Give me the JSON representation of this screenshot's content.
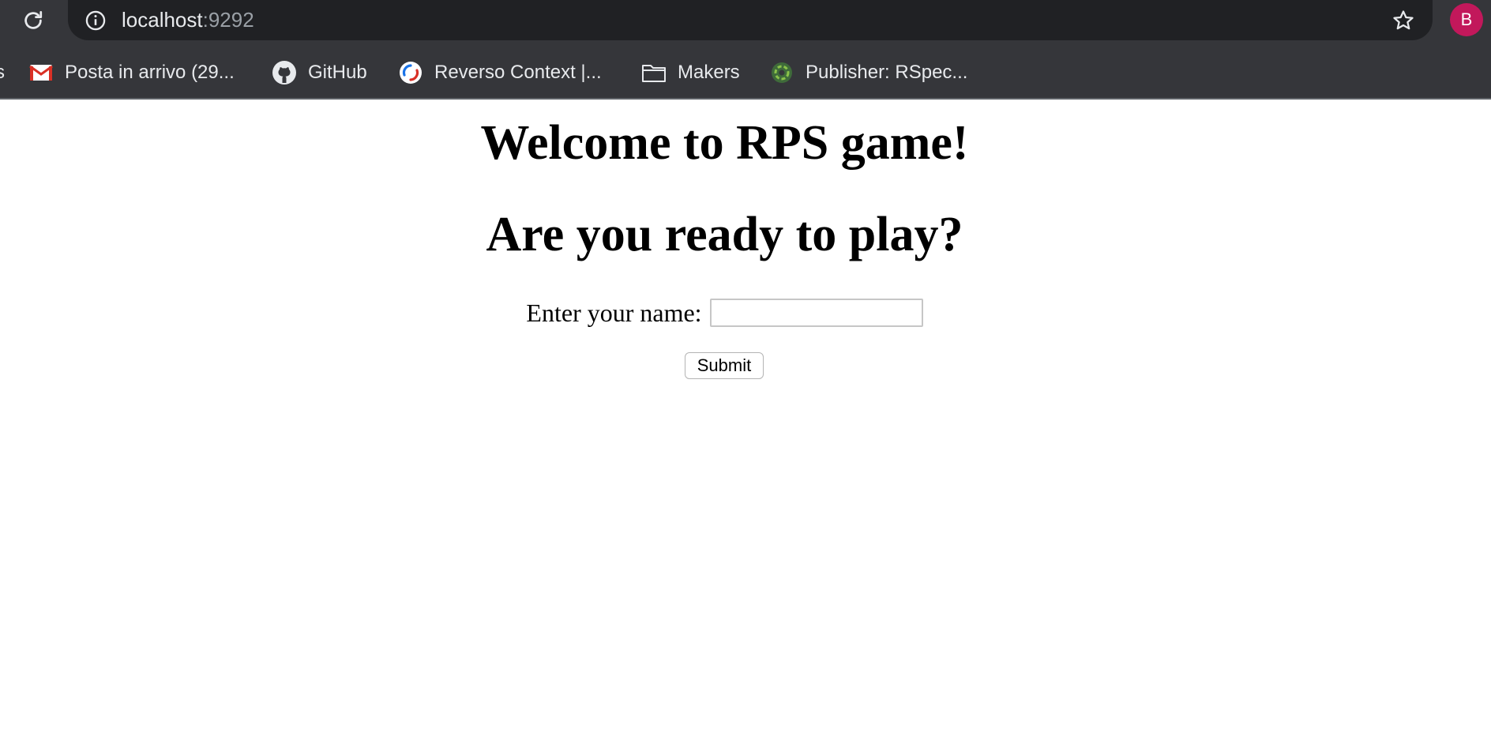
{
  "browser": {
    "url_host": "localhost",
    "url_port": ":9292",
    "profile_initial": "B",
    "bookmarks": [
      {
        "label": "Posta in arrivo (29...",
        "icon": "gmail-icon"
      },
      {
        "label": "GitHub",
        "icon": "github-icon"
      },
      {
        "label": "Reverso Context |...",
        "icon": "reverso-icon"
      },
      {
        "label": "Makers",
        "icon": "folder-icon"
      },
      {
        "label": "Publisher: RSpec...",
        "icon": "publisher-icon"
      }
    ]
  },
  "page": {
    "heading": "Welcome to RPS game!",
    "subheading": "Are you ready to play?",
    "name_label": "Enter your name:",
    "name_value": "",
    "submit_label": "Submit"
  },
  "colors": {
    "chrome_bg": "#35363a",
    "omnibox_bg": "#202124",
    "avatar_bg": "#c2185b"
  }
}
